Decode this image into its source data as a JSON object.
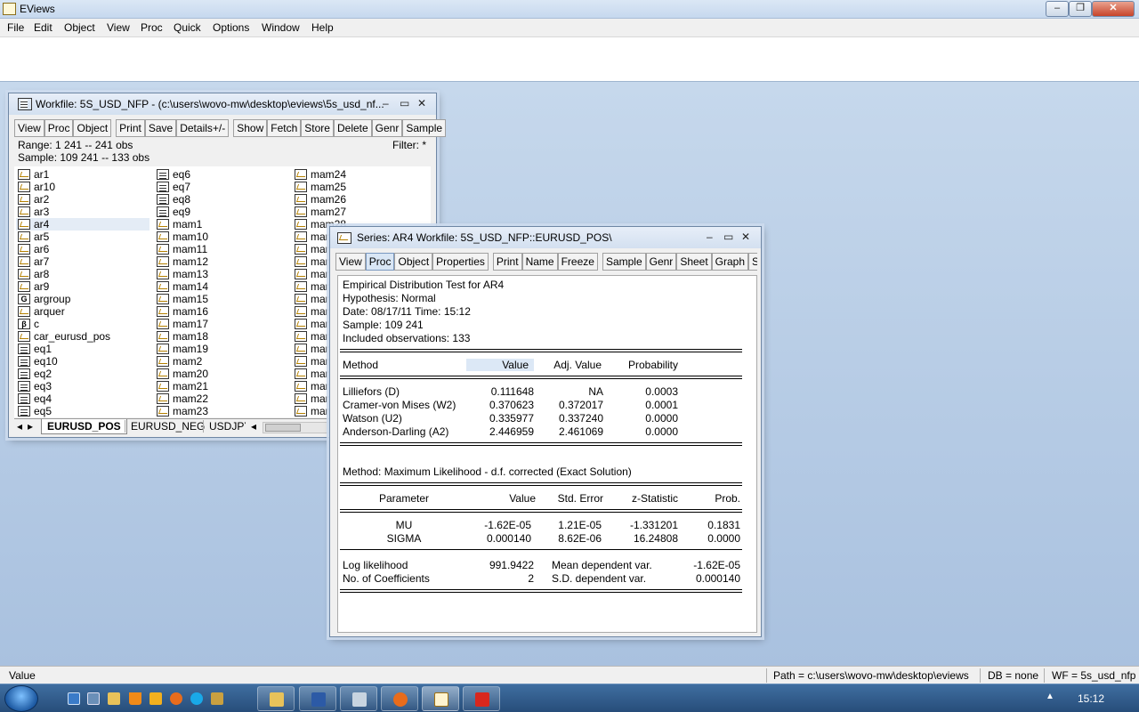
{
  "app": {
    "title": "EViews"
  },
  "menu": [
    "File",
    "Edit",
    "Object",
    "View",
    "Proc",
    "Quick",
    "Options",
    "Window",
    "Help"
  ],
  "workfile": {
    "title": "Workfile: 5S_USD_NFP - (c:\\users\\wovo-mw\\desktop\\eviews\\5s_usd_nf...",
    "toolbar": [
      "View",
      "Proc",
      "Object",
      "Print",
      "Save",
      "Details+/-",
      "Show",
      "Fetch",
      "Store",
      "Delete",
      "Genr",
      "Sample"
    ],
    "range": "Range:  1 241  --  241 obs",
    "sample": "Sample: 109 241  --  133 obs",
    "filter": "Filter: *",
    "col1": [
      {
        "name": "ar1",
        "type": "series"
      },
      {
        "name": "ar10",
        "type": "series"
      },
      {
        "name": "ar2",
        "type": "series"
      },
      {
        "name": "ar3",
        "type": "series"
      },
      {
        "name": "ar4",
        "type": "series"
      },
      {
        "name": "ar5",
        "type": "series"
      },
      {
        "name": "ar6",
        "type": "series"
      },
      {
        "name": "ar7",
        "type": "series"
      },
      {
        "name": "ar8",
        "type": "series"
      },
      {
        "name": "ar9",
        "type": "series"
      },
      {
        "name": "argroup",
        "type": "group"
      },
      {
        "name": "arquer",
        "type": "series"
      },
      {
        "name": "c",
        "type": "coef"
      },
      {
        "name": "car_eurusd_pos",
        "type": "series"
      },
      {
        "name": "eq1",
        "type": "equation"
      },
      {
        "name": "eq10",
        "type": "equation"
      },
      {
        "name": "eq2",
        "type": "equation"
      },
      {
        "name": "eq3",
        "type": "equation"
      },
      {
        "name": "eq4",
        "type": "equation"
      },
      {
        "name": "eq5",
        "type": "equation"
      }
    ],
    "col2": [
      {
        "name": "eq6",
        "type": "equation"
      },
      {
        "name": "eq7",
        "type": "equation"
      },
      {
        "name": "eq8",
        "type": "equation"
      },
      {
        "name": "eq9",
        "type": "equation"
      },
      {
        "name": "mam1",
        "type": "series"
      },
      {
        "name": "mam10",
        "type": "series"
      },
      {
        "name": "mam11",
        "type": "series"
      },
      {
        "name": "mam12",
        "type": "series"
      },
      {
        "name": "mam13",
        "type": "series"
      },
      {
        "name": "mam14",
        "type": "series"
      },
      {
        "name": "mam15",
        "type": "series"
      },
      {
        "name": "mam16",
        "type": "series"
      },
      {
        "name": "mam17",
        "type": "series"
      },
      {
        "name": "mam18",
        "type": "series"
      },
      {
        "name": "mam19",
        "type": "series"
      },
      {
        "name": "mam2",
        "type": "series"
      },
      {
        "name": "mam20",
        "type": "series"
      },
      {
        "name": "mam21",
        "type": "series"
      },
      {
        "name": "mam22",
        "type": "series"
      },
      {
        "name": "mam23",
        "type": "series"
      }
    ],
    "col3": [
      {
        "name": "mam24",
        "type": "series"
      },
      {
        "name": "mam25",
        "type": "series"
      },
      {
        "name": "mam26",
        "type": "series"
      },
      {
        "name": "mam27",
        "type": "series"
      },
      {
        "name": "mam28",
        "type": "series"
      },
      {
        "name": "mar",
        "type": "series"
      },
      {
        "name": "mar",
        "type": "series"
      },
      {
        "name": "mar",
        "type": "series"
      },
      {
        "name": "mar",
        "type": "series"
      },
      {
        "name": "mar",
        "type": "series"
      },
      {
        "name": "mar",
        "type": "series"
      },
      {
        "name": "mar",
        "type": "series"
      },
      {
        "name": "mar",
        "type": "series"
      },
      {
        "name": "mar",
        "type": "series"
      },
      {
        "name": "mar",
        "type": "series"
      },
      {
        "name": "mar",
        "type": "series"
      },
      {
        "name": "mar",
        "type": "series"
      },
      {
        "name": "mar",
        "type": "series"
      },
      {
        "name": "mar",
        "type": "series"
      },
      {
        "name": "mar",
        "type": "series"
      }
    ],
    "selected_item": "ar4",
    "tabs": [
      "EURUSD_POS",
      "EURUSD_NEG",
      "USDJPY"
    ],
    "active_tab": "EURUSD_POS"
  },
  "series": {
    "title": "Series: AR4   Workfile: 5S_USD_NFP::EURUSD_POS\\",
    "toolbar": [
      "View",
      "Proc",
      "Object",
      "Properties",
      "Print",
      "Name",
      "Freeze",
      "Sample",
      "Genr",
      "Sheet",
      "Graph",
      "Stats"
    ],
    "header": [
      "Empirical Distribution Test for AR4",
      "Hypothesis: Normal",
      "Date: 08/17/11   Time: 15:12",
      "Sample: 109 241",
      "Included observations: 133"
    ],
    "t1_head": [
      "Method",
      "Value",
      "Adj. Value",
      "Probability"
    ],
    "t1_rows": [
      [
        "Lilliefors (D)",
        "0.111648",
        "NA",
        "0.0003"
      ],
      [
        "Cramer-von Mises (W2)",
        "0.370623",
        "0.372017",
        "0.0001"
      ],
      [
        "Watson (U2)",
        "0.335977",
        "0.337240",
        "0.0000"
      ],
      [
        "Anderson-Darling (A2)",
        "2.446959",
        "2.461069",
        "0.0000"
      ]
    ],
    "method_line": "Method: Maximum Likelihood - d.f. corrected (Exact Solution)",
    "t2_head": [
      "Parameter",
      "Value",
      "Std. Error",
      "z-Statistic",
      "Prob."
    ],
    "t2_rows": [
      [
        "MU",
        "-1.62E-05",
        "1.21E-05",
        "-1.331201",
        "0.1831"
      ],
      [
        "SIGMA",
        "0.000140",
        "8.62E-06",
        "16.24808",
        "0.0000"
      ]
    ],
    "t3_rows": [
      [
        "Log likelihood",
        "991.9422",
        "Mean dependent var.",
        "-1.62E-05"
      ],
      [
        "No. of Coefficients",
        "2",
        "S.D. dependent var.",
        "0.000140"
      ]
    ]
  },
  "statusbar": {
    "left": "Value",
    "path": "Path = c:\\users\\wovo-mw\\desktop\\eviews",
    "db": "DB = none",
    "wf": "WF = 5s_usd_nfp"
  },
  "taskbar": {
    "clock": "15:12"
  },
  "colors": {
    "desktop": "#b8cde3",
    "taskbar": "#274d7a",
    "selection": "#e4ecf6",
    "close": "#c7442a"
  }
}
